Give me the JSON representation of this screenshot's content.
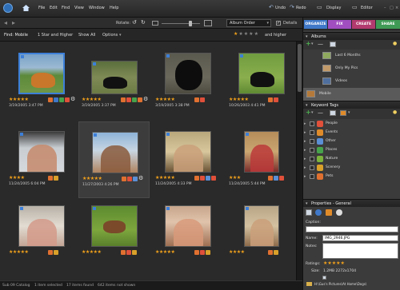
{
  "menubar": {
    "items": [
      "File",
      "Edit",
      "Find",
      "View",
      "Window",
      "Help"
    ],
    "undo": "Undo",
    "redo": "Redo",
    "display": "Display",
    "editor": "Editor"
  },
  "toolbar": {
    "rotate_label": "Rotate:",
    "sort_value": "Album Order",
    "details_label": "Details"
  },
  "findbar": {
    "find_label": "Find: Mobile",
    "rating_filter": "1 Star and Higher",
    "show_all": "Show All",
    "options": "Options",
    "and_higher": "and higher",
    "star_glyph": "★"
  },
  "tabs": {
    "organize": "ORGANIZE",
    "fix": "FIX",
    "create": "CREATE",
    "share": "SHARE",
    "colors": {
      "organize": "#3f78c8",
      "fix": "#a04ec0",
      "create": "#b23a6e",
      "share": "#3e9a55"
    }
  },
  "albums": {
    "header": "Albums",
    "items": [
      {
        "label": "Last 6 Months",
        "selected": false
      },
      {
        "label": "Only My Pics",
        "selected": false
      },
      {
        "label": "Videos",
        "selected": false
      },
      {
        "label": "Mobile",
        "selected": true
      }
    ]
  },
  "keywords": {
    "header": "Keyword Tags",
    "items": [
      {
        "label": "People",
        "color": "#e0503a"
      },
      {
        "label": "Events",
        "color": "#e08b2a"
      },
      {
        "label": "Other",
        "color": "#5b8fd6"
      },
      {
        "label": "Places",
        "color": "#47a34b"
      },
      {
        "label": "Nature",
        "color": "#7cb33d"
      },
      {
        "label": "Scenery",
        "color": "#d9a02a"
      },
      {
        "label": "Pets",
        "color": "#e07030"
      }
    ]
  },
  "properties": {
    "header": "Properties - General",
    "caption_label": "Caption:",
    "name_label": "Name:",
    "name_value": "IMG_2946.JPG",
    "notes_label": "Notes:",
    "ratings_label": "Ratings:",
    "ratings_value": "★★★★★",
    "size_label": "Size:",
    "size_value": "1.2MB  2272x1704",
    "path_value": "H:\\Gus's Pictures\\At Home\\Dogs\\"
  },
  "photos": [
    {
      "stars": "★★★★★",
      "date": "3/19/2005 3:47 PM",
      "tags": [
        "#e07030",
        "#3f78c8",
        "#47a34b",
        "#e0503a"
      ],
      "gear": true,
      "sel": false,
      "first": true
    },
    {
      "stars": "★★★★★",
      "date": "3/19/2005 3:37 PM",
      "tags": [
        "#e07030",
        "#e0503a",
        "#47a34b",
        "#e07030"
      ],
      "gear": true,
      "sel": false,
      "first": false
    },
    {
      "stars": "★★★★★",
      "date": "3/19/2005 3:38 PM",
      "tags": [
        "#e07030",
        "#e0503a"
      ],
      "gear": false,
      "sel": false,
      "first": false
    },
    {
      "stars": "★★★★★",
      "date": "10/26/2003 4:41 PM",
      "tags": [
        "#e07030",
        "#e0503a"
      ],
      "gear": false,
      "sel": false,
      "first": false
    },
    {
      "stars": "★★★★",
      "date": "11/24/2005 6:04 PM",
      "tags": [
        "#e07030",
        "#d9a02a"
      ],
      "gear": false,
      "sel": false,
      "first": false
    },
    {
      "stars": "★★★★★",
      "date": "11/27/2003 4:26 PM",
      "tags": [
        "#e07030",
        "#e0503a",
        "#5b8fd6"
      ],
      "gear": true,
      "sel": true,
      "first": false
    },
    {
      "stars": "★★★★★",
      "date": "11/24/2005 4:33 PM",
      "tags": [
        "#e07030",
        "#e0503a",
        "#5b8fd6",
        "#e0503a"
      ],
      "gear": false,
      "sel": false,
      "first": false
    },
    {
      "stars": "★★★",
      "date": "11/24/2005 5:44 PM",
      "tags": [
        "#e07030",
        "#5b8fd6",
        "#e0503a"
      ],
      "gear": false,
      "sel": false,
      "first": false
    },
    {
      "stars": "★★★★★",
      "date": "",
      "tags": [
        "#e07030",
        "#d9a02a"
      ],
      "gear": false,
      "sel": false,
      "first": false
    },
    {
      "stars": "★★★★★",
      "date": "",
      "tags": [
        "#e07030",
        "#e0503a",
        "#d9a02a"
      ],
      "gear": false,
      "sel": false,
      "first": false
    },
    {
      "stars": "★★★★★",
      "date": "",
      "tags": [
        "#e07030",
        "#e0503a",
        "#d9a02a"
      ],
      "gear": false,
      "sel": false,
      "first": false
    },
    {
      "stars": "★★★★",
      "date": "",
      "tags": [
        "#e07030",
        "#d9a02a"
      ],
      "gear": false,
      "sel": false,
      "first": false
    }
  ],
  "status": {
    "catalog": "Sub 09 Catalog",
    "selected": "1 item selected",
    "found": "17 items found",
    "not_shown": "642 items not shown"
  }
}
